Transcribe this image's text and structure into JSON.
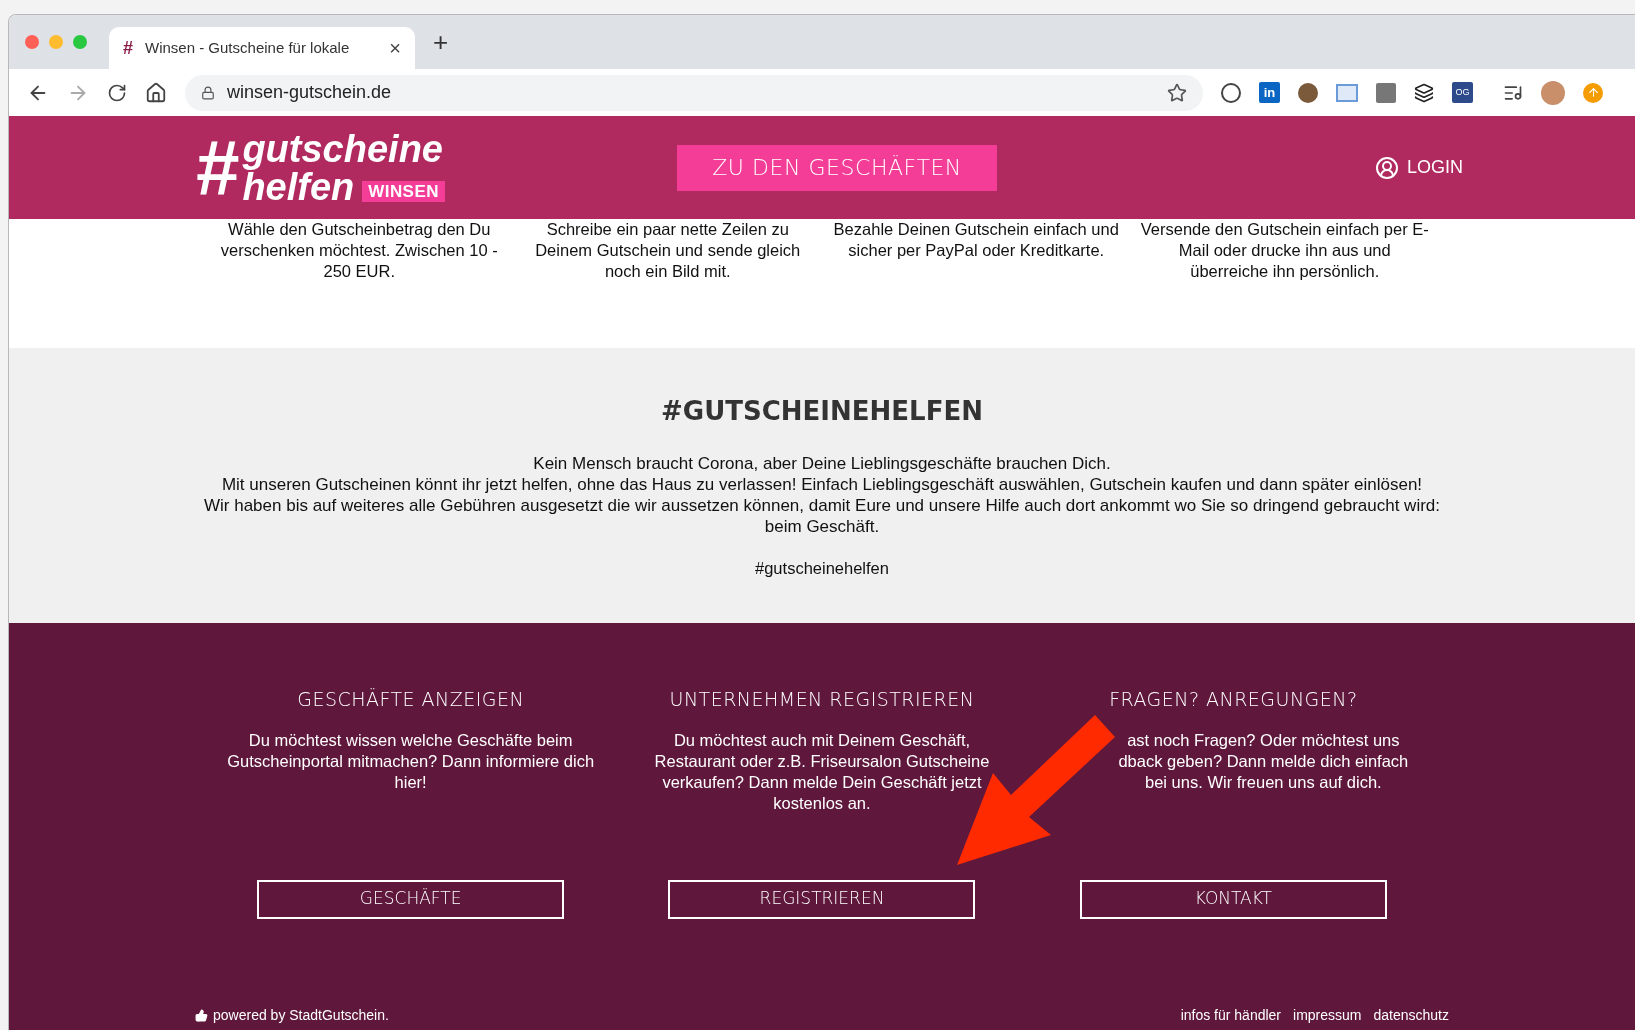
{
  "browser": {
    "tab": {
      "icon": "#",
      "title": "Winsen - Gutscheine für lokale",
      "close": "×"
    },
    "new_tab": "+",
    "url": "winsen-gutschein.de",
    "extensions": [
      "in",
      "OG"
    ]
  },
  "header": {
    "logo": {
      "line1": "gutscheine",
      "line2": "helfen",
      "badge": "WINSEN"
    },
    "cta": "ZU DEN GESCHÄFTEN",
    "login": "LOGIN"
  },
  "steps": [
    "Wähle den Gutscheinbetrag den Du verschenken möchtest. Zwischen 10 - 250 EUR.",
    "Schreibe ein paar nette Zeilen zu Deinem Gutschein und sende gleich noch ein Bild mit.",
    "Bezahle Deinen Gutschein einfach und sicher per PayPal oder Kreditkarte.",
    "Versende den Gutschein einfach per E-Mail oder drucke ihn aus und überreiche ihn persönlich."
  ],
  "about": {
    "title": "#GUTSCHEINEHELFEN",
    "paragraphs": [
      "Kein Mensch braucht Corona, aber Deine Lieblingsgeschäfte brauchen Dich.",
      "Mit unseren Gutscheinen könnt ihr jetzt helfen, ohne das Haus zu verlassen! Einfach Lieblingsgeschäft auswählen, Gutschein kaufen und dann später einlösen!",
      "Wir haben bis auf weiteres alle Gebühren ausgesetzt die wir aussetzen können, damit Eure und unsere Hilfe auch dort ankommt wo Sie so dringend gebraucht wird: beim Geschäft."
    ],
    "hashtag": "#gutscheinehelfen"
  },
  "footer": {
    "columns": [
      {
        "title": "GESCHÄFTE ANZEIGEN",
        "text": "Du möchtest wissen welche Geschäfte beim Gutscheinportal mitmachen? Dann informiere dich hier!",
        "button": "GESCHÄFTE"
      },
      {
        "title": "UNTERNEHMEN REGISTRIEREN",
        "text": "Du möchtest auch mit Deinem Geschäft, Restaurant oder z.B. Friseursalon Gutscheine verkaufen? Dann melde Dein Geschäft jetzt kostenlos an.",
        "button": "REGISTRIEREN"
      },
      {
        "title": "FRAGEN? ANREGUNGEN?",
        "text": "ast noch Fragen? Oder möchtest uns dback geben? Dann melde dich einfach bei uns. Wir freuen uns auf dich.",
        "button": "KONTAKT"
      }
    ],
    "powered": "powered by StadtGutschein.",
    "links": [
      "infos für händler",
      "impressum",
      "datenschutz"
    ]
  }
}
